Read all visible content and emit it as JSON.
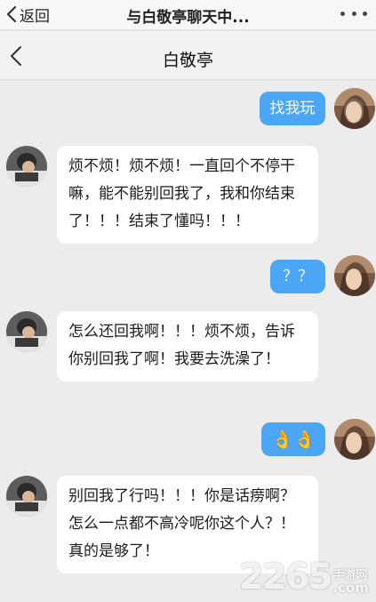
{
  "top_bar": {
    "back_label": "返回",
    "title": "与白敬亭聊天中...",
    "more_icon": "more-dots-icon"
  },
  "chat_header": {
    "back_icon": "chevron-left-icon",
    "contact_name": "白敬亭"
  },
  "messages": [
    {
      "sender": "self",
      "text": "找我玩"
    },
    {
      "sender": "contact",
      "text": "烦不烦！烦不烦！一直回个不停干嘛，能不能别回我了，我和你结束了！！！结束了懂吗！！！"
    },
    {
      "sender": "self",
      "text": "？？"
    },
    {
      "sender": "contact",
      "text": "怎么还回我啊！！！烦不烦，告诉你别回我了啊！我要去洗澡了！"
    },
    {
      "sender": "self",
      "text": "👌👌"
    },
    {
      "sender": "contact",
      "text": "别回我了行吗！！！你是话痨啊？怎么一点都不高冷呢你这个人？！真的是够了！"
    }
  ],
  "watermark": {
    "number": "2265",
    "site": "手游网",
    "domain": ".com"
  },
  "colors": {
    "outgoing_bubble": "#4ba6f5",
    "incoming_bubble": "#ffffff",
    "chat_background": "#ececec"
  }
}
